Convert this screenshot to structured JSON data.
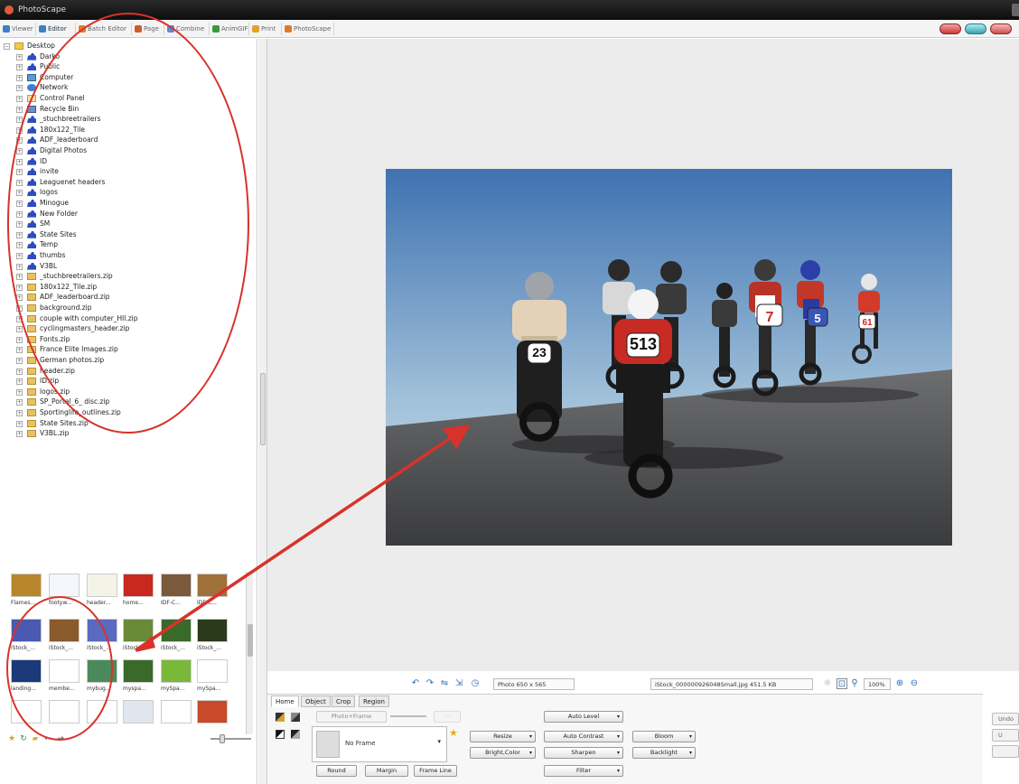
{
  "app": {
    "title": "PhotoScape"
  },
  "tabs": [
    {
      "label": "Viewer",
      "color": "#3d7fc9"
    },
    {
      "label": "Editor",
      "color": "#3d7fc9",
      "active": true
    },
    {
      "label": "Batch Editor",
      "color": "#e07c2a"
    },
    {
      "label": "Page",
      "color": "#d05a2a"
    },
    {
      "label": "Combine",
      "color": "#5a8ad0"
    },
    {
      "label": "AnimGIF",
      "color": "#3a9a3a"
    },
    {
      "label": "Print",
      "color": "#e0a030"
    },
    {
      "label": "PhotoScape",
      "color": "#e07a2a"
    }
  ],
  "tree": [
    {
      "label": "Desktop",
      "icon": "folder",
      "depth": 0
    },
    {
      "label": "Darko",
      "icon": "person",
      "depth": 1
    },
    {
      "label": "Public",
      "icon": "person",
      "depth": 1
    },
    {
      "label": "Computer",
      "icon": "comp",
      "depth": 1
    },
    {
      "label": "Network",
      "icon": "net",
      "depth": 1
    },
    {
      "label": "Control Panel",
      "icon": "panel",
      "depth": 1
    },
    {
      "label": "Recycle Bin",
      "icon": "bin",
      "depth": 1
    },
    {
      "label": "_stuchbreetrailers",
      "icon": "person",
      "depth": 1
    },
    {
      "label": "180x122_Tile",
      "icon": "person",
      "depth": 1
    },
    {
      "label": "ADF_leaderboard",
      "icon": "person",
      "depth": 1
    },
    {
      "label": "Digital Photos",
      "icon": "person",
      "depth": 1
    },
    {
      "label": "ID",
      "icon": "person",
      "depth": 1
    },
    {
      "label": "invite",
      "icon": "person",
      "depth": 1
    },
    {
      "label": "Leaguenet headers",
      "icon": "person",
      "depth": 1
    },
    {
      "label": "logos",
      "icon": "person",
      "depth": 1
    },
    {
      "label": "Minogue",
      "icon": "person",
      "depth": 1
    },
    {
      "label": "New Folder",
      "icon": "person",
      "depth": 1
    },
    {
      "label": "SM",
      "icon": "person",
      "depth": 1
    },
    {
      "label": "State Sites",
      "icon": "person",
      "depth": 1
    },
    {
      "label": "Temp",
      "icon": "person",
      "depth": 1
    },
    {
      "label": "thumbs",
      "icon": "person",
      "depth": 1
    },
    {
      "label": "V3BL",
      "icon": "person",
      "depth": 1
    },
    {
      "label": "_stuchbreetrailers.zip",
      "icon": "zip",
      "depth": 1
    },
    {
      "label": "180x122_Tile.zip",
      "icon": "zip",
      "depth": 1
    },
    {
      "label": "ADF_leaderboard.zip",
      "icon": "zip",
      "depth": 1
    },
    {
      "label": "background.zip",
      "icon": "zip",
      "depth": 1
    },
    {
      "label": "couple with computer_Hll.zip",
      "icon": "zip",
      "depth": 1
    },
    {
      "label": "cyclingmasters_header.zip",
      "icon": "zip",
      "depth": 1
    },
    {
      "label": "Fonts.zip",
      "icon": "zip",
      "depth": 1
    },
    {
      "label": "France Elite Images.zip",
      "icon": "zip",
      "depth": 1
    },
    {
      "label": "German photos.zip",
      "icon": "zip",
      "depth": 1
    },
    {
      "label": "header.zip",
      "icon": "zip",
      "depth": 1
    },
    {
      "label": "ID.zip",
      "icon": "zip",
      "depth": 1
    },
    {
      "label": "logos.zip",
      "icon": "zip",
      "depth": 1
    },
    {
      "label": "SP_Portal_6_ disc.zip",
      "icon": "zip",
      "depth": 1
    },
    {
      "label": "Sportinglife_outlines.zip",
      "icon": "zip",
      "depth": 1
    },
    {
      "label": "State Sites.zip",
      "icon": "zip",
      "depth": 1
    },
    {
      "label": "V3BL.zip",
      "icon": "zip",
      "depth": 1
    }
  ],
  "thumbnails": [
    {
      "label": "Flames...",
      "bg": "#b8862a"
    },
    {
      "label": "footyw...",
      "bg": "#f3f6fb"
    },
    {
      "label": "header...",
      "bg": "#f3f3e8"
    },
    {
      "label": "home...",
      "bg": "#c8281e"
    },
    {
      "label": "IDF-C...",
      "bg": "#7a5a3a"
    },
    {
      "label": "IDF-C...",
      "bg": "#a0703a"
    },
    {
      "label": "iStock_...",
      "bg": "#4a5ab0"
    },
    {
      "label": "iStock_...",
      "bg": "#8a5a2a"
    },
    {
      "label": "iStock_...",
      "bg": "#5a6ac0"
    },
    {
      "label": "iStock_...",
      "bg": "#6a8a3a"
    },
    {
      "label": "iStock_...",
      "bg": "#3a6a2a"
    },
    {
      "label": "iStock_...",
      "bg": "#2a3a1a"
    },
    {
      "label": "landing...",
      "bg": "#1a3a7a"
    },
    {
      "label": "membe...",
      "bg": "#ffffff"
    },
    {
      "label": "mybug...",
      "bg": "#4a8a5a"
    },
    {
      "label": "myspa...",
      "bg": "#3a6a2a"
    },
    {
      "label": "mySpa...",
      "bg": "#7ab83a"
    },
    {
      "label": "mySpa...",
      "bg": "#ffffff"
    },
    {
      "label": "",
      "bg": "#ffffff"
    },
    {
      "label": "",
      "bg": "#ffffff"
    },
    {
      "label": "",
      "bg": "#ffffff"
    },
    {
      "label": "",
      "bg": "#dfe6ee"
    },
    {
      "label": "",
      "bg": "#ffffff"
    },
    {
      "label": "",
      "bg": "#c84a2a"
    }
  ],
  "status": {
    "photo_size": "Photo 650 x 565",
    "file": "iStock_000000926048Small.jpg  451.5 KB",
    "zoom": "100%"
  },
  "editor": {
    "tabs": [
      "Home",
      "Object",
      "Crop",
      "Region"
    ],
    "photo_frame": "Photo+Frame",
    "frame_value": "No Frame",
    "buttons": {
      "round": "Round",
      "margin": "Margin",
      "frame_line": "Frame Line",
      "resize": "Resize",
      "bright_color": "Bright,Color",
      "auto_level": "Auto Level",
      "auto_contrast": "Auto Contrast",
      "sharpen": "Sharpen",
      "filter": "Filter",
      "bloom": "Bloom",
      "backlight": "Backlight"
    },
    "right_stubs": [
      "Undo",
      "U",
      ""
    ]
  },
  "photo_numbers": [
    "23",
    "513",
    "7",
    "5",
    "61"
  ],
  "colors": {
    "annotation": "#d8322a",
    "sky_top": "#4d7fba",
    "sky_bottom": "#c8dbe8",
    "road": "#58595b"
  }
}
